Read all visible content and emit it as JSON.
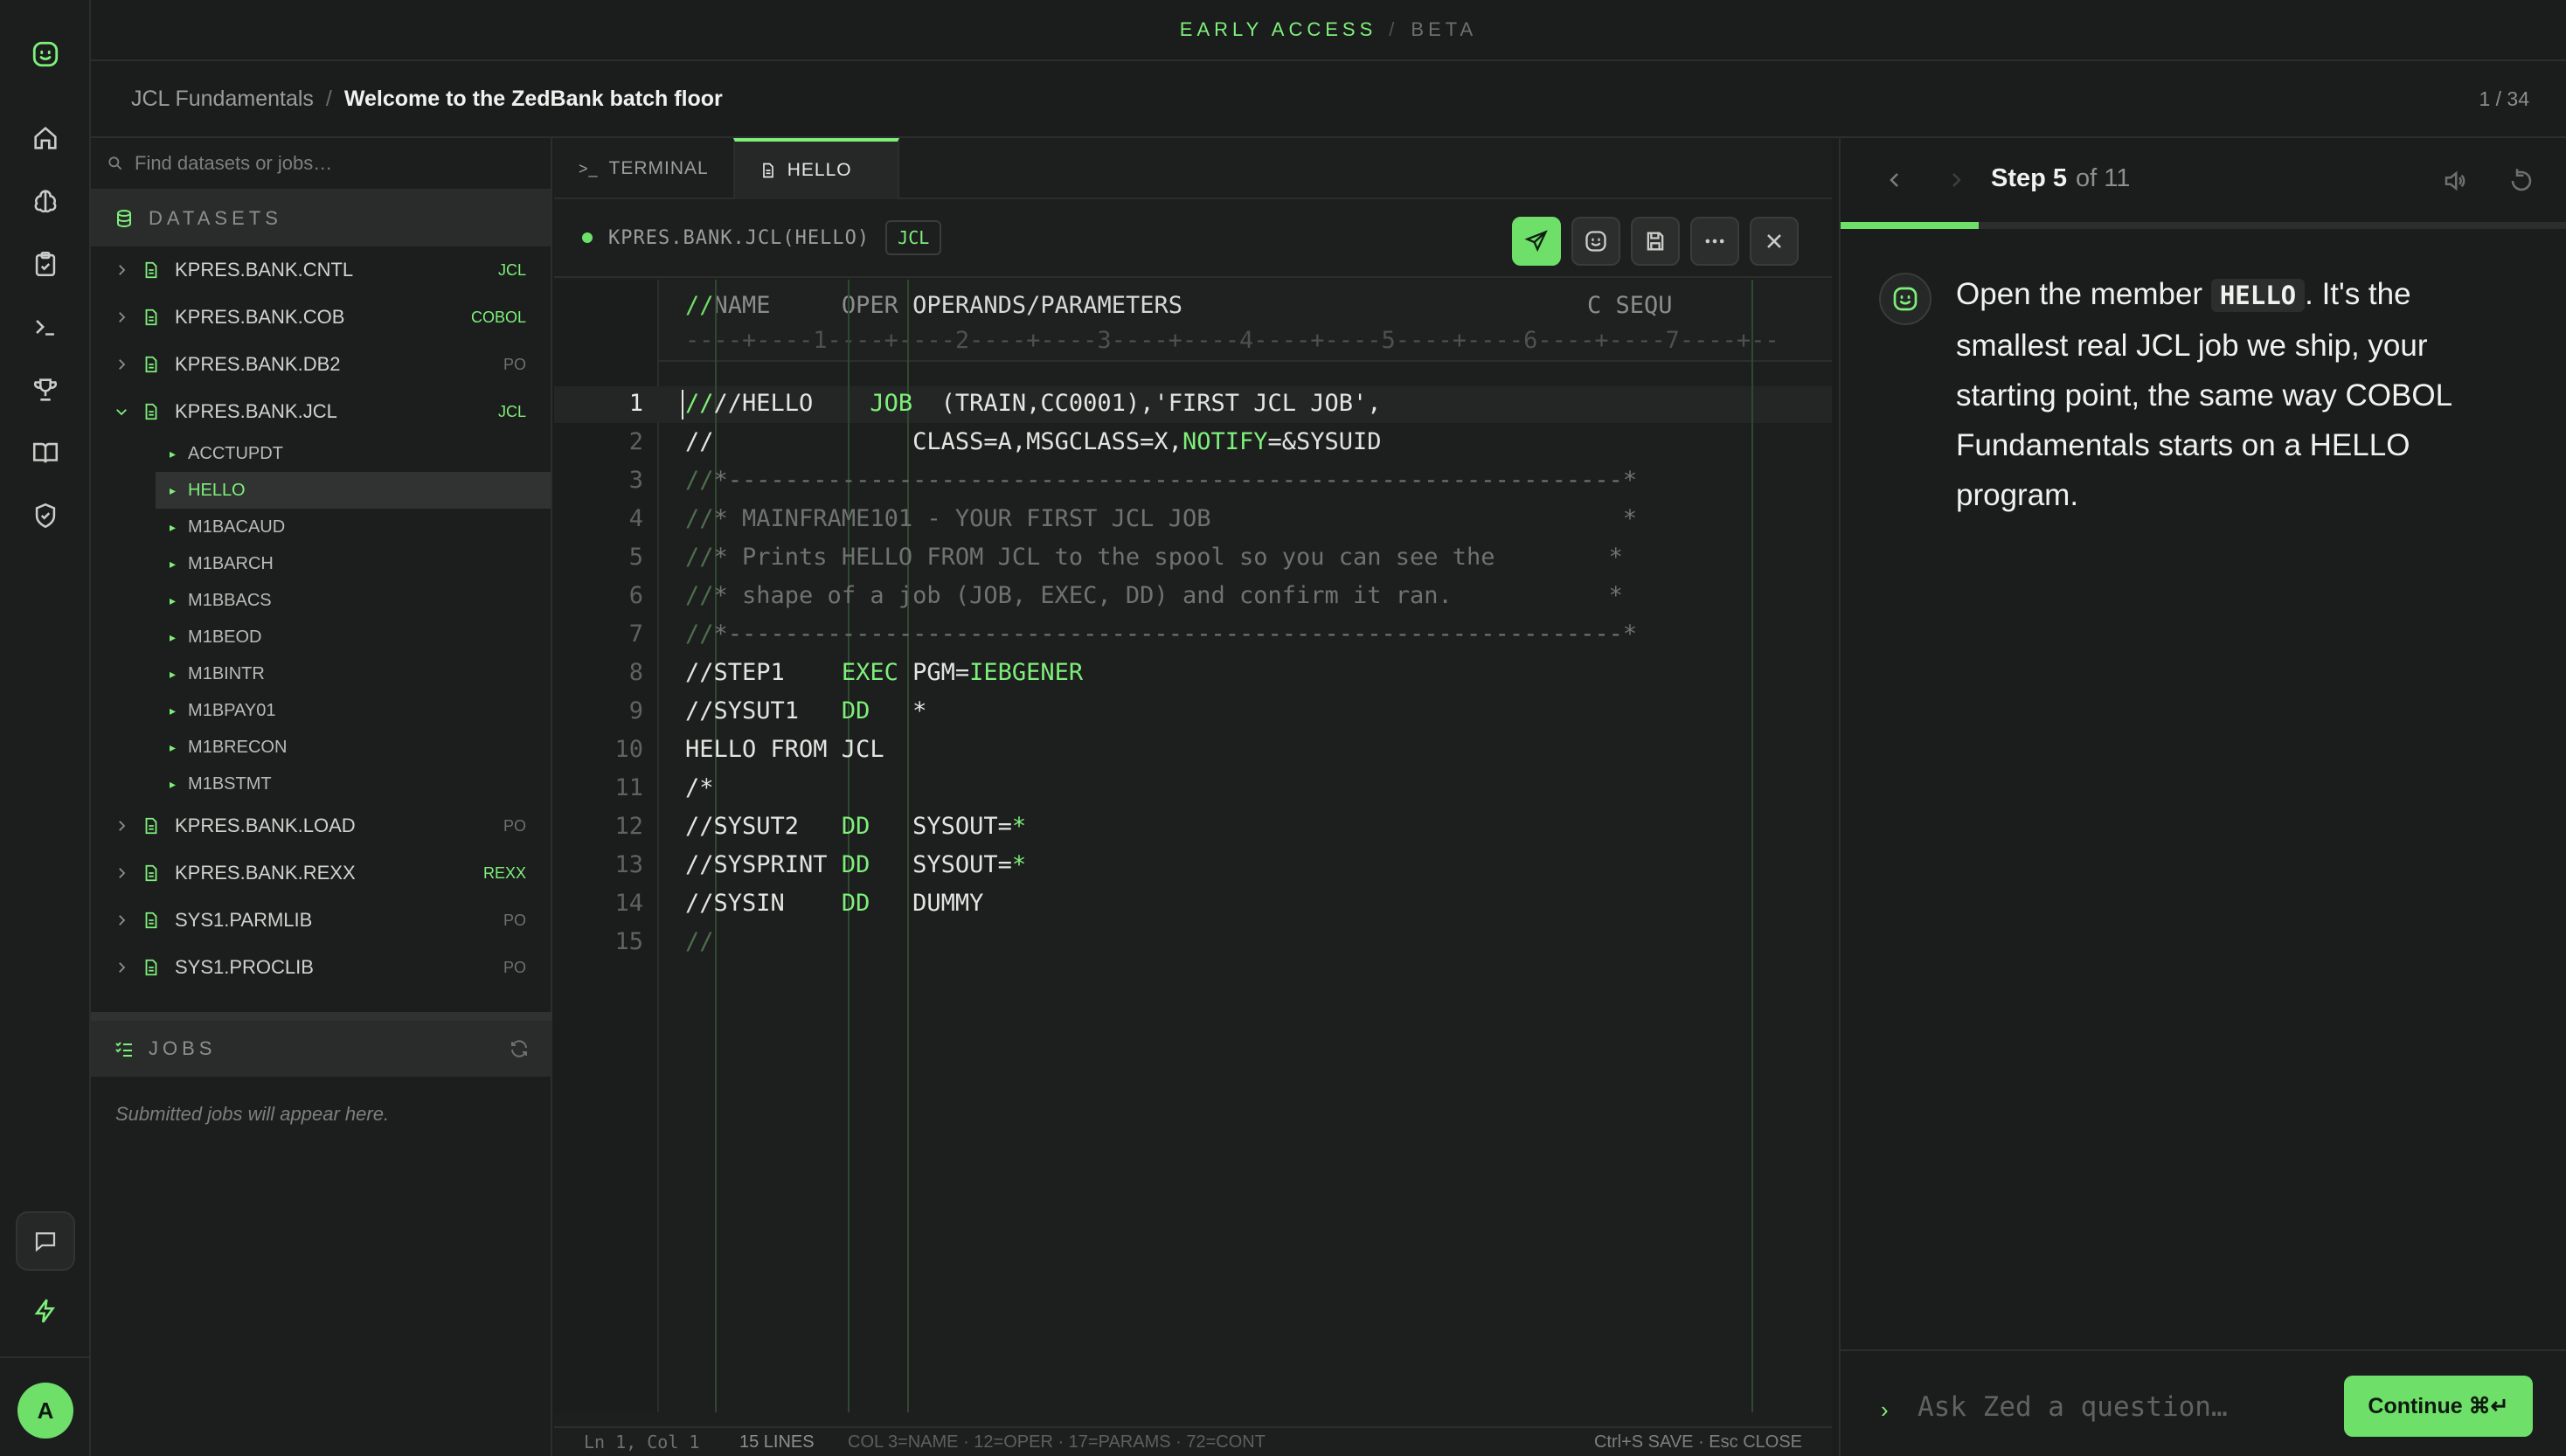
{
  "banner": {
    "early_access": "EARLY ACCESS",
    "separator": "/",
    "beta": "BETA"
  },
  "breadcrumb": {
    "course": "JCL Fundamentals",
    "separator": "/",
    "lesson": "Welcome to the ZedBank batch floor",
    "page": "1 / 34"
  },
  "rail": {
    "avatar": "A"
  },
  "explorer": {
    "search_placeholder": "Find datasets or jobs…",
    "datasets_title": "DATASETS",
    "datasets": [
      {
        "name": "KPRES.BANK.CNTL",
        "tag": "JCL"
      },
      {
        "name": "KPRES.BANK.COB",
        "tag": "COBOL"
      },
      {
        "name": "KPRES.BANK.DB2",
        "tag": "PO"
      },
      {
        "name": "KPRES.BANK.JCL",
        "tag": "JCL"
      },
      {
        "name": "KPRES.BANK.LOAD",
        "tag": "PO"
      },
      {
        "name": "KPRES.BANK.REXX",
        "tag": "REXX"
      },
      {
        "name": "SYS1.PARMLIB",
        "tag": "PO"
      },
      {
        "name": "SYS1.PROCLIB",
        "tag": "PO"
      }
    ],
    "members": [
      "ACCTUPDT",
      "HELLO",
      "M1BACAUD",
      "M1BARCH",
      "M1BBACS",
      "M1BEOD",
      "M1BINTR",
      "M1BPAY01",
      "M1BRECON",
      "M1BSTMT"
    ],
    "jobs_title": "JOBS",
    "jobs_empty": "Submitted jobs will appear here."
  },
  "editor": {
    "tabs": [
      "TERMINAL",
      "HELLO"
    ],
    "file_name": "KPRES.BANK.JCL(HELLO)",
    "language": "JCL",
    "ruler_header": {
      "slashes": "//",
      "name": "NAME",
      "oper": "OPER",
      "operands": "OPERANDS/PARAMETERS",
      "cont": "C",
      "seq": "SEQU"
    },
    "ruler_scale": "----+----1----+----2----+----3----+----4----+----5----+----6----+----7----+--",
    "line_numbers": [
      "1",
      "2",
      "3",
      "4",
      "5",
      "6",
      "7",
      "8",
      "9",
      "10",
      "11",
      "12",
      "13",
      "14",
      "15"
    ],
    "lines": {
      "l1_a": "//HELLO    ",
      "l1_b": "JOB",
      "l1_c": "  (TRAIN,CC0001),'FIRST JCL JOB',",
      "l2_a": "//              CLASS=A,MSGCLASS=X,",
      "l2_b": "NOTIFY",
      "l2_c": "=&SYSUID",
      "l3_a": "//",
      "l3_b": "*---------------------------------------------------------------*",
      "l4_a": "//",
      "l4_b": "* MAINFRAME101 - YOUR FIRST JCL JOB                             *",
      "l5_a": "//",
      "l5_b": "* Prints HELLO FROM JCL to the spool so you can see the        *",
      "l6_a": "//",
      "l6_b": "* shape of a job (JOB, EXEC, DD) and confirm it ran.           *",
      "l7_a": "//",
      "l7_b": "*---------------------------------------------------------------*",
      "l8_a": "//STEP1    ",
      "l8_b": "EXEC",
      "l8_c": " PGM=",
      "l8_d": "IEBGENER",
      "l9_a": "//SYSUT1   ",
      "l9_b": "DD",
      "l9_c": "   *",
      "l10": "HELLO FROM JCL",
      "l11": "/*",
      "l12_a": "//SYSUT2   ",
      "l12_b": "DD",
      "l12_c": "   SYSOUT=",
      "l12_d": "*",
      "l13_a": "//SYSPRINT ",
      "l13_b": "DD",
      "l13_c": "   SYSOUT=",
      "l13_d": "*",
      "l14_a": "//SYSIN    ",
      "l14_b": "DD",
      "l14_c": "   DUMMY",
      "l15": "//"
    },
    "status": {
      "position": "Ln 1, Col 1",
      "lines": "15 LINES",
      "columns": "COL 3=NAME · 12=OPER · 17=PARAMS · 72=CONT",
      "keys": "Ctrl+S SAVE · Esc CLOSE"
    }
  },
  "tutor": {
    "step_label": "Step 5",
    "step_total": "of 11",
    "progress_fraction": 0.19,
    "message_a": "Open the member ",
    "message_code": "HELLO",
    "message_b": ". It's the smallest real JCL job we ship, your starting point, the same way COBOL Fundamentals starts on a HELLO program.",
    "ask_placeholder": "Ask Zed a question…",
    "continue_label": "Continue ⌘↵"
  },
  "colors": {
    "accent": "#6ee06a",
    "background": "#1b1c1c"
  }
}
